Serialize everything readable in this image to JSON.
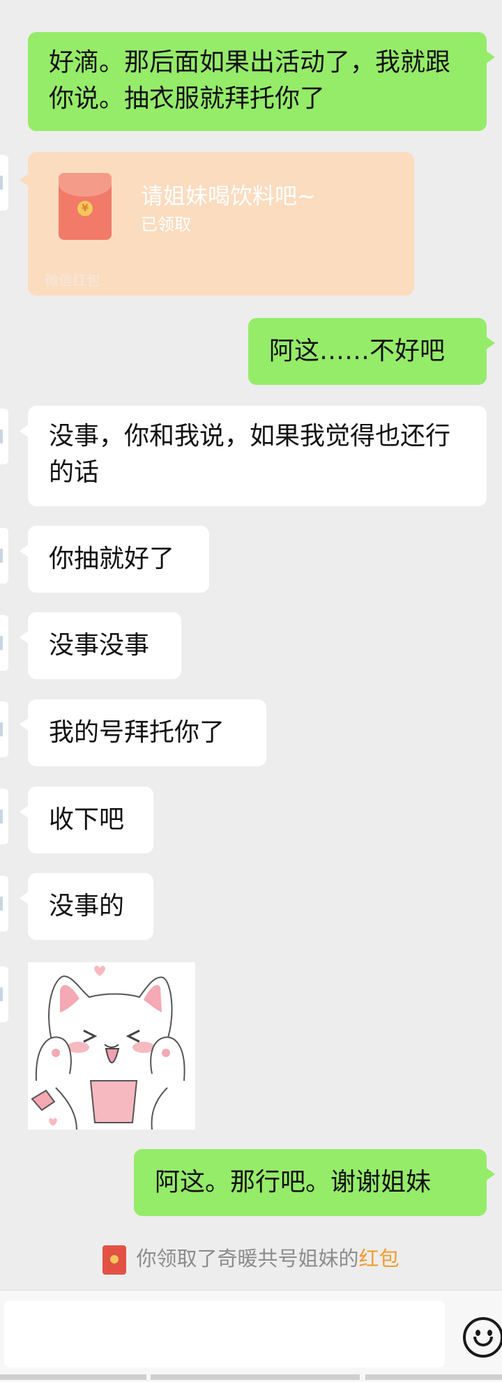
{
  "messages": [
    {
      "dir": "out",
      "text": "好滴。那后面如果出活动了，我就跟你说。抽衣服就拜托你了"
    },
    {
      "dir": "out",
      "text": "阿这……不好吧"
    },
    {
      "dir": "in",
      "text": "没事，你和我说，如果我觉得也还行的话"
    },
    {
      "dir": "in",
      "text": "你抽就好了"
    },
    {
      "dir": "in",
      "text": "没事没事"
    },
    {
      "dir": "in",
      "text": "我的号拜托你了"
    },
    {
      "dir": "in",
      "text": "收下吧"
    },
    {
      "dir": "in",
      "text": "没事的"
    },
    {
      "dir": "out",
      "text": "阿这。那行吧。谢谢姐妹"
    }
  ],
  "red_packet": {
    "title": "请姐妹喝饮料吧~",
    "status": "已领取",
    "label": "微信红包",
    "coin_symbol": "¥"
  },
  "system_notice": {
    "prefix": "你领取了奇暖共号姐妹的",
    "highlight": "红包"
  },
  "colors": {
    "background": "#ededed",
    "outgoing_bubble": "#95ec69",
    "incoming_bubble": "#ffffff",
    "red_packet_bg": "#fcdcbf",
    "highlight": "#f39b2e"
  },
  "icons": [
    "red-packet-icon",
    "emoji-icon",
    "sticker-cat-image"
  ]
}
